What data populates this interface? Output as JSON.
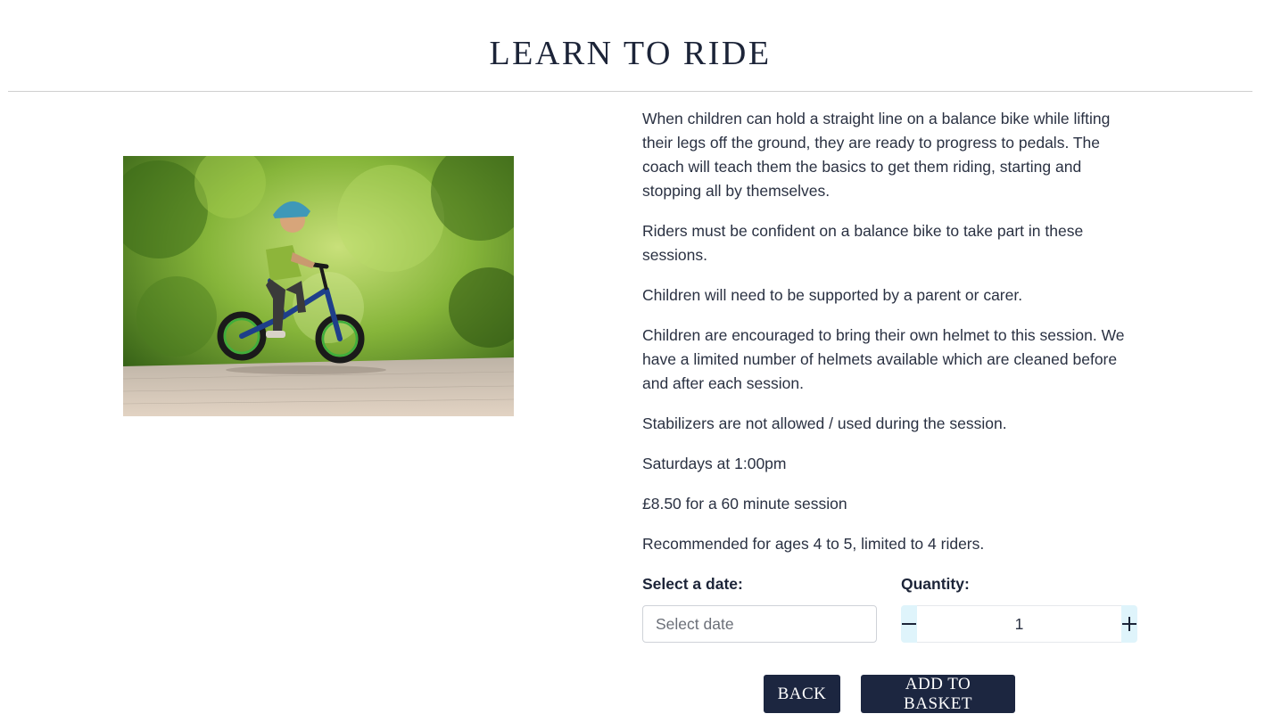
{
  "header": {
    "title": "LEARN TO RIDE"
  },
  "product": {
    "image_icon": "child-on-bike-photo",
    "description": [
      "When children can hold a straight line on a balance bike while lifting their legs off the ground, they are ready to progress to pedals. The coach will teach them the basics to get them riding, starting and stopping all by themselves.",
      "Riders must be confident on a balance bike to take part in these sessions.",
      "Children will need to be supported by a parent or carer.",
      "Children are encouraged to bring their own helmet to this session. We have a limited number of helmets available which are cleaned before and after each session.",
      "Stabilizers are not allowed / used during the session.",
      "Saturdays at 1:00pm",
      "£8.50 for a 60 minute session",
      "Recommended for ages 4 to 5, limited to 4 riders."
    ]
  },
  "form": {
    "date_label": "Select a date:",
    "date_placeholder": "Select date",
    "date_value": "",
    "quantity_label": "Quantity:",
    "quantity_value": "1",
    "minus_icon": "minus-icon",
    "plus_icon": "plus-icon"
  },
  "actions": {
    "back_label": "BACK",
    "add_label": "ADD TO BASKET"
  },
  "colors": {
    "primary": "#1c2640",
    "stepper_bg": "#dff4fb",
    "text": "#2a3142"
  }
}
